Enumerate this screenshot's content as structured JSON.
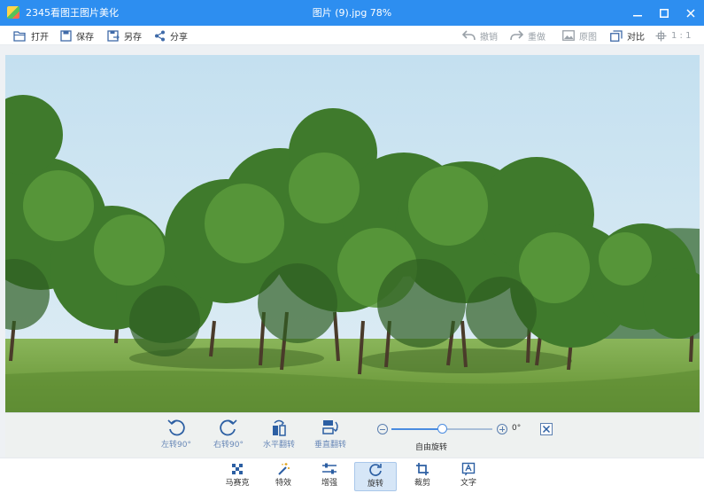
{
  "window": {
    "app_title": "2345看图王图片美化",
    "doc_title": "图片 (9).jpg   78%",
    "controls": [
      "minimize-icon",
      "maximize-icon",
      "close-icon"
    ]
  },
  "toolbar": {
    "open": "打开",
    "save": "保存",
    "save_as": "另存",
    "share": "分享",
    "undo": "撤销",
    "redo": "重做",
    "original": "原图",
    "compare": "对比",
    "one_to_one": "1 : 1"
  },
  "rotate_panel": {
    "rotate_left": "左转90°",
    "rotate_right": "右转90°",
    "flip_horizontal": "水平翻转",
    "flip_vertical": "垂直翻转",
    "angle": "0°",
    "angle_fraction": 0.5,
    "free_rotate": "自由旋转"
  },
  "bottom_tools": {
    "items": [
      {
        "label": "马赛克",
        "icon": "mosaic-icon"
      },
      {
        "label": "特效",
        "icon": "magic-wand-icon"
      },
      {
        "label": "增强",
        "icon": "sliders-icon"
      },
      {
        "label": "旋转",
        "icon": "rotate-icon"
      },
      {
        "label": "裁剪",
        "icon": "crop-icon"
      },
      {
        "label": "文字",
        "icon": "text-icon"
      }
    ],
    "active_index": 3
  },
  "colors": {
    "titlebar": "#2d8ef0",
    "accent": "#4a8ce0",
    "active_tool_bg": "#d6e6f7"
  }
}
